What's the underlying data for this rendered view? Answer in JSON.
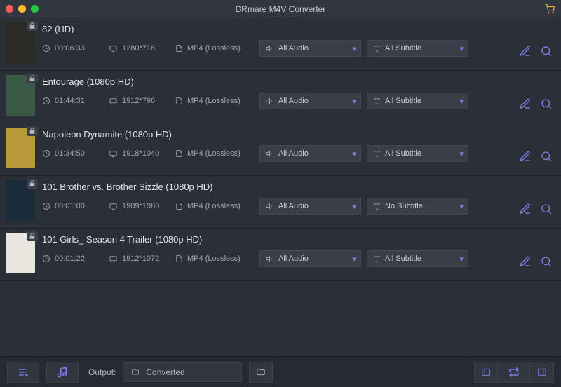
{
  "app": {
    "title": "DRmare M4V Converter"
  },
  "items": [
    {
      "title": "82 (HD)",
      "duration": "00:06:33",
      "resolution": "1280*718",
      "format": "MP4 (Lossless)",
      "audio": "All Audio",
      "subtitle": "All Subtitle",
      "thumb_bg": "#2d2b26"
    },
    {
      "title": "Entourage (1080p HD)",
      "duration": "01:44:31",
      "resolution": "1912*796",
      "format": "MP4 (Lossless)",
      "audio": "All Audio",
      "subtitle": "All Subtitle",
      "thumb_bg": "#3a5a45"
    },
    {
      "title": "Napoleon Dynamite (1080p HD)",
      "duration": "01:34:50",
      "resolution": "1918*1040",
      "format": "MP4 (Lossless)",
      "audio": "All Audio",
      "subtitle": "All Subtitle",
      "thumb_bg": "#b89a3a"
    },
    {
      "title": "101 Brother vs. Brother Sizzle (1080p HD)",
      "duration": "00:01:00",
      "resolution": "1909*1080",
      "format": "MP4 (Lossless)",
      "audio": "All Audio",
      "subtitle": "No Subtitle",
      "thumb_bg": "#1a2b3a"
    },
    {
      "title": "101 Girls_ Season 4 Trailer (1080p HD)",
      "duration": "00:01:22",
      "resolution": "1912*1072",
      "format": "MP4 (Lossless)",
      "audio": "All Audio",
      "subtitle": "All Subtitle",
      "thumb_bg": "#e8e5de"
    }
  ],
  "footer": {
    "output_label": "Output:",
    "output_path": "Converted"
  }
}
